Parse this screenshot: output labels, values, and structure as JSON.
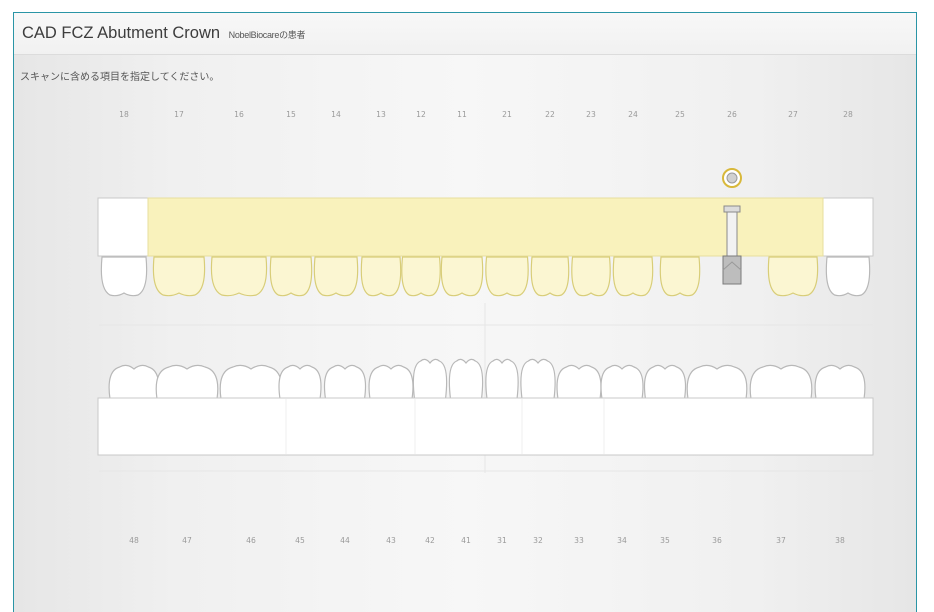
{
  "window": {
    "title": "CAD FCZ Abutment Crown",
    "subtitle": "NobelBiocareの患者",
    "instruction": "スキャンに含める項目を指定してください。"
  },
  "upper_teeth": [
    "18",
    "17",
    "16",
    "15",
    "14",
    "13",
    "12",
    "11",
    "21",
    "22",
    "23",
    "24",
    "25",
    "26",
    "27",
    "28"
  ],
  "lower_teeth": [
    "48",
    "47",
    "46",
    "45",
    "44",
    "43",
    "42",
    "41",
    "31",
    "32",
    "33",
    "34",
    "35",
    "36",
    "37",
    "38"
  ],
  "selection": {
    "highlighted_range": [
      "17",
      "27"
    ],
    "implant_position": "26",
    "highlight_color": "#f8f0b0",
    "highlight_border": "#ddd48a"
  }
}
